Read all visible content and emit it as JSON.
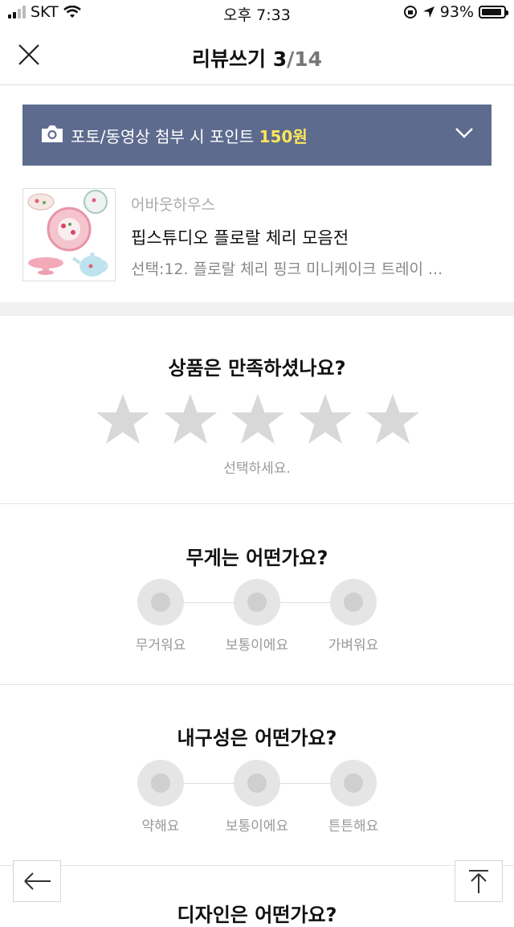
{
  "status": {
    "carrier": "SKT",
    "time": "오후 7:33",
    "battery": "93%",
    "battery_level": 0.93
  },
  "header": {
    "title": "리뷰쓰기",
    "current": "3",
    "total": "/14",
    "close_icon": "close-icon"
  },
  "banner": {
    "text": "포토/동영상 첨부 시 포인트 ",
    "points": "150원",
    "bg": "#5d6b8e",
    "accent": "#ffe65a",
    "icons": [
      "camera-icon",
      "chevron-down-icon"
    ]
  },
  "product": {
    "brand": "어바웃하우스",
    "name": "핍스튜디오 플로랄 체리 모음전",
    "option": "선택:12. 플로랄 체리 핑크 미니케이크 트레이 ..."
  },
  "rating": {
    "question": "상품은 만족하셨나요?",
    "hint": "선택하세요.",
    "stars": 5
  },
  "weight": {
    "question": "무게는 어떤가요?",
    "options": [
      "무거워요",
      "보통이에요",
      "가벼워요"
    ]
  },
  "durability": {
    "question": "내구성은 어떤가요?",
    "options": [
      "약해요",
      "보통이에요",
      "튼튼해요"
    ]
  },
  "next": {
    "question": "디자인은 어떤가요?"
  },
  "nav": {
    "icons": [
      "arrow-left-icon",
      "scroll-top-icon"
    ]
  }
}
